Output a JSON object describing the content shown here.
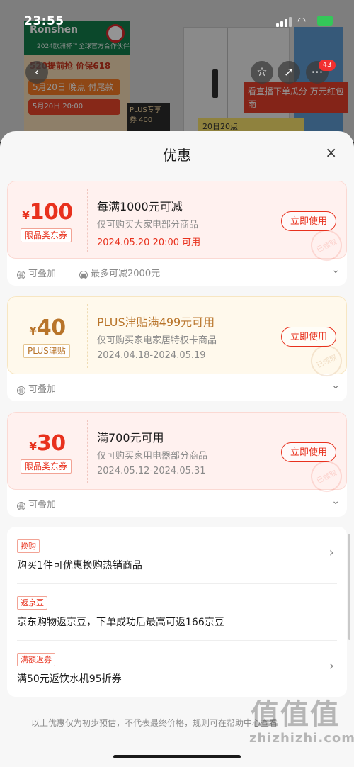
{
  "status_bar": {
    "time": "23:55"
  },
  "background": {
    "brand": "Ronshen",
    "brand_subtitle": "2024欧洲杯™全球官方合作伙伴",
    "promo_line1": "5月20日 晚点 付尾款",
    "promo_line2": "520提前抢 价保618",
    "promo_line3": "5月20日 20:00",
    "plus_box": "PLUS专享券 400",
    "red_banner": "看直播下单瓜分 万元红包雨",
    "yellow_banner": "20日20点",
    "cart_badge": "43"
  },
  "sheet": {
    "title": "优惠",
    "close_icon": "×"
  },
  "coupons": [
    {
      "currency": "¥",
      "amount": "100",
      "tag": "限品类东券",
      "title": "每满1000元可减",
      "desc": "仅可购买大家电部分商品",
      "date": "2024.05.20 20:00 可用",
      "button": "立即使用",
      "stamp": "已领取",
      "foot1": "可叠加",
      "foot2": "最多可减2000元",
      "color": "#e8311d"
    },
    {
      "currency": "¥",
      "amount": "40",
      "tag": "PLUS津贴",
      "title": "PLUS津贴满499元可用",
      "desc": "仅可购买家电家居特权卡商品",
      "date": "2024.04.18-2024.05.19",
      "button": "立即使用",
      "stamp": "已领取",
      "foot1": "可叠加",
      "color": "#b8742a"
    },
    {
      "currency": "¥",
      "amount": "30",
      "tag": "限品类东券",
      "title": "满700元可用",
      "desc": "仅可购买家用电器部分商品",
      "date": "2024.05.12-2024.05.31",
      "button": "立即使用",
      "stamp": "已领取",
      "foot1": "可叠加",
      "color": "#e8311d"
    }
  ],
  "benefits": [
    {
      "tag": "换购",
      "text": "购买1件可优惠换购热销商品"
    },
    {
      "tag": "返京豆",
      "text": "京东购物返京豆，下单成功后最高可返166京豆"
    },
    {
      "tag": "满额返券",
      "text": "满50元返饮水机95折券"
    }
  ],
  "disclaimer": "以上优惠仅为初步预估，不代表最终价格，规则可在帮助中心查看",
  "watermark": {
    "logo": "值值值",
    "site": "zhizhizhi.com"
  }
}
